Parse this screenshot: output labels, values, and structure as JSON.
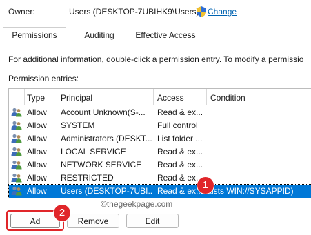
{
  "owner": {
    "label": "Owner:",
    "value": "Users (DESKTOP-7UBIHK9\\Users)",
    "change_link": "Change"
  },
  "tabs": [
    {
      "label": "Permissions",
      "active": true
    },
    {
      "label": "Auditing",
      "active": false
    },
    {
      "label": "Effective Access",
      "active": false
    }
  ],
  "info_text": "For additional information, double-click a permission entry. To modify a permissio",
  "entries_label": "Permission entries:",
  "table": {
    "headers": {
      "type": "Type",
      "principal": "Principal",
      "access": "Access",
      "condition": "Condition"
    },
    "rows": [
      {
        "icon": "user-group-icon",
        "type": "Allow",
        "principal": "Account Unknown(S-...",
        "access": "Read & ex...",
        "condition": "",
        "selected": false
      },
      {
        "icon": "user-group-icon",
        "type": "Allow",
        "principal": "SYSTEM",
        "access": "Full control",
        "condition": "",
        "selected": false
      },
      {
        "icon": "user-group-icon",
        "type": "Allow",
        "principal": "Administrators (DESKT...",
        "access": "List folder ...",
        "condition": "",
        "selected": false
      },
      {
        "icon": "user-group-icon",
        "type": "Allow",
        "principal": "LOCAL SERVICE",
        "access": "Read & ex...",
        "condition": "",
        "selected": false
      },
      {
        "icon": "user-group-icon",
        "type": "Allow",
        "principal": "NETWORK SERVICE",
        "access": "Read & ex...",
        "condition": "",
        "selected": false
      },
      {
        "icon": "user-group-icon",
        "type": "Allow",
        "principal": "RESTRICTED",
        "access": "Read & ex...",
        "condition": "",
        "selected": false
      },
      {
        "icon": "user-group-icon",
        "type": "Allow",
        "principal": "Users (DESKTOP-7UBI...",
        "access": "Read & ex...",
        "condition": "xists WIN://SYSAPPID)",
        "selected": true
      }
    ]
  },
  "buttons": {
    "add": {
      "label": "Add",
      "mnemonic": "d",
      "label_rest": "d",
      "label_first": "A"
    },
    "remove": {
      "label": "Remove",
      "label_first": "R",
      "label_rest": "emove"
    },
    "edit": {
      "label": "Edit",
      "label_first": "E",
      "label_rest": "dit"
    }
  },
  "callouts": {
    "one": "1",
    "two": "2"
  },
  "watermark": "©thegeekpage.com",
  "colors": {
    "selection": "#0078d7",
    "callout": "#e0262a",
    "link": "#0063b1"
  }
}
